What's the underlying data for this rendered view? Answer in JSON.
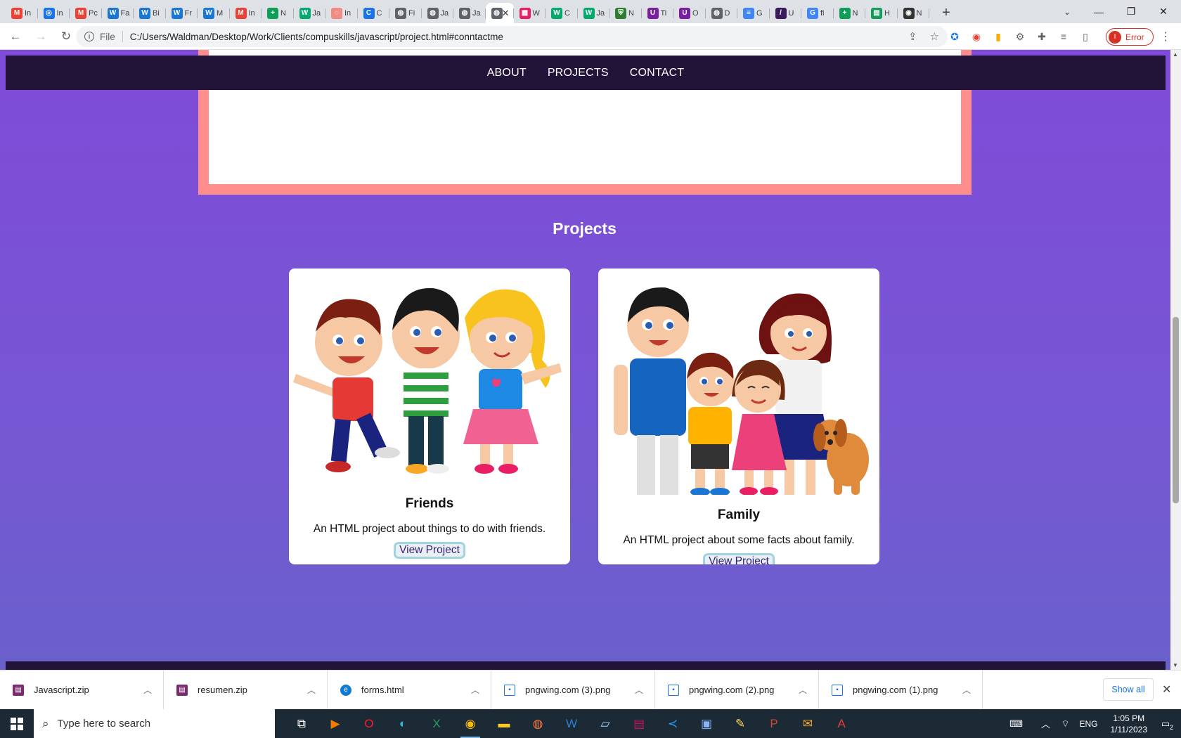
{
  "browser": {
    "tabs": [
      {
        "icon": "gmail-icon",
        "label": "In",
        "color": "#ea4335",
        "glyph": "M"
      },
      {
        "icon": "safari-icon",
        "label": "In",
        "color": "#1a73e8",
        "glyph": "◎"
      },
      {
        "icon": "gmail-icon",
        "label": "Pc",
        "color": "#ea4335",
        "glyph": "M"
      },
      {
        "icon": "wix-icon",
        "label": "Fa",
        "color": "#1976d2",
        "glyph": "W"
      },
      {
        "icon": "wix-icon",
        "label": "Bi",
        "color": "#1976d2",
        "glyph": "W"
      },
      {
        "icon": "wix-icon",
        "label": "Fr",
        "color": "#1976d2",
        "glyph": "W"
      },
      {
        "icon": "wix-icon",
        "label": "M",
        "color": "#1976d2",
        "glyph": "W"
      },
      {
        "icon": "gmail-icon",
        "label": "In",
        "color": "#ea4335",
        "glyph": "M"
      },
      {
        "icon": "sheets-plus-icon",
        "label": "N",
        "color": "#0f9d58",
        "glyph": "+"
      },
      {
        "icon": "w3-icon",
        "label": "Ja",
        "color": "#04aa6d",
        "glyph": "W"
      },
      {
        "icon": "pdf-icon",
        "label": "In",
        "color": "#f28b82",
        "glyph": "◌"
      },
      {
        "icon": "c-icon",
        "label": "C",
        "color": "#1a73e8",
        "glyph": "C"
      },
      {
        "icon": "globe-icon",
        "label": "Fi",
        "color": "#5f6368",
        "glyph": "◍"
      },
      {
        "icon": "globe-icon",
        "label": "Ja",
        "color": "#5f6368",
        "glyph": "◍"
      },
      {
        "icon": "globe-icon",
        "label": "Ja",
        "color": "#5f6368",
        "glyph": "◍"
      },
      {
        "icon": "globe-icon",
        "label": "",
        "color": "#5f6368",
        "glyph": "◍",
        "active": true
      },
      {
        "icon": "multicolor-icon",
        "label": "W",
        "color": "#e91e63",
        "glyph": "▦"
      },
      {
        "icon": "w3-icon",
        "label": "C",
        "color": "#04aa6d",
        "glyph": "W"
      },
      {
        "icon": "w3-icon",
        "label": "Ja",
        "color": "#04aa6d",
        "glyph": "W"
      },
      {
        "icon": "shield-icon",
        "label": "N",
        "color": "#2e7d32",
        "glyph": "⛨"
      },
      {
        "icon": "purple-u-icon",
        "label": "Ti",
        "color": "#7b1fa2",
        "glyph": "U"
      },
      {
        "icon": "purple-u-icon",
        "label": "O",
        "color": "#7b1fa2",
        "glyph": "U"
      },
      {
        "icon": "globe-icon",
        "label": "D",
        "color": "#5f6368",
        "glyph": "◍"
      },
      {
        "icon": "docs-icon",
        "label": "G",
        "color": "#4285f4",
        "glyph": "≡"
      },
      {
        "icon": "dark-square-icon",
        "label": "U",
        "color": "#3c1a5b",
        "glyph": "/"
      },
      {
        "icon": "google-icon",
        "label": "fi",
        "color": "#4285f4",
        "glyph": "G"
      },
      {
        "icon": "sheets-plus-icon",
        "label": "N",
        "color": "#0f9d58",
        "glyph": "+"
      },
      {
        "icon": "sheets-icon",
        "label": "H",
        "color": "#0f9d58",
        "glyph": "▤"
      },
      {
        "icon": "github-icon",
        "label": "N",
        "color": "#333333",
        "glyph": "◉"
      }
    ],
    "url_scheme": "File",
    "url": "C:/Users/Waldman/Desktop/Work/Clients/compuskills/javascript/project.html#conntactme",
    "profile_status": "Error",
    "profile_initial": "I"
  },
  "site": {
    "nav": [
      {
        "label": "ABOUT"
      },
      {
        "label": "PROJECTS"
      },
      {
        "label": "CONTACT"
      }
    ],
    "projects_title": "Projects",
    "projects": [
      {
        "title": "Friends",
        "description": "An HTML project about things to do with friends.",
        "button": "View Project"
      },
      {
        "title": "Family",
        "description": "An HTML project about some facts about family.",
        "button": "View Project"
      }
    ]
  },
  "downloads": {
    "items": [
      {
        "name": "Javascript.zip",
        "icon": "winrar-icon"
      },
      {
        "name": "resumen.zip",
        "icon": "winrar-icon"
      },
      {
        "name": "forms.html",
        "icon": "edge-icon"
      },
      {
        "name": "pngwing.com (3).png",
        "icon": "image-file-icon"
      },
      {
        "name": "pngwing.com (2).png",
        "icon": "image-file-icon"
      },
      {
        "name": "pngwing.com (1).png",
        "icon": "image-file-icon"
      }
    ],
    "show_all": "Show all"
  },
  "taskbar": {
    "search_placeholder": "Type here to search",
    "language": "ENG",
    "time": "1:05 PM",
    "date": "1/11/2023",
    "notification_count": "2"
  }
}
